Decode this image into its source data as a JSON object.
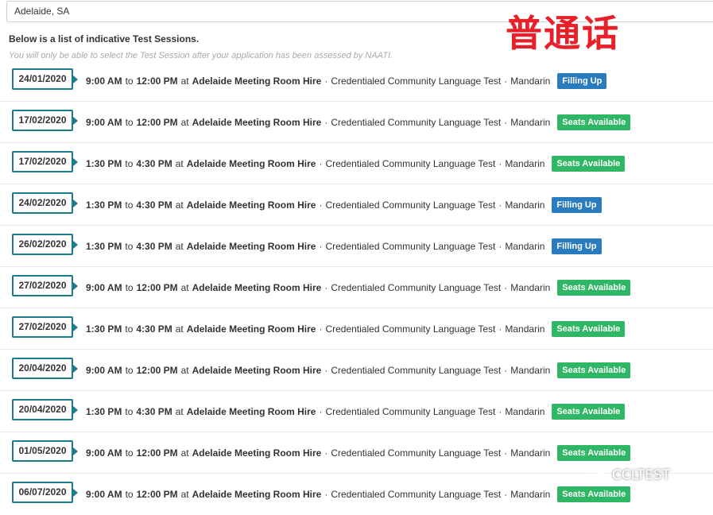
{
  "location": {
    "value": "Adelaide, SA"
  },
  "heading": "Below is a list of indicative Test Sessions.",
  "note": "You will only be able to select the Test Session after your application has been assessed by NAATI.",
  "watermark_title": "普通话",
  "watermark_brand": "CCLTEST",
  "separator": "·",
  "labels": {
    "to": "to",
    "at": "at"
  },
  "colors": {
    "date_border": "#1b7a8c",
    "filling_up": "#2a7cbf",
    "seats_available": "#2fb765",
    "watermark": "#e8202a"
  },
  "sessions": [
    {
      "date": "24/01/2020",
      "start": "9:00 AM",
      "end": "12:00 PM",
      "venue": "Adelaide Meeting Room Hire",
      "test": "Credentialed Community Language Test",
      "language": "Mandarin",
      "status": "Filling Up",
      "status_type": "filling"
    },
    {
      "date": "17/02/2020",
      "start": "9:00 AM",
      "end": "12:00 PM",
      "venue": "Adelaide Meeting Room Hire",
      "test": "Credentialed Community Language Test",
      "language": "Mandarin",
      "status": "Seats Available",
      "status_type": "seats"
    },
    {
      "date": "17/02/2020",
      "start": "1:30 PM",
      "end": "4:30 PM",
      "venue": "Adelaide Meeting Room Hire",
      "test": "Credentialed Community Language Test",
      "language": "Mandarin",
      "status": "Seats Available",
      "status_type": "seats"
    },
    {
      "date": "24/02/2020",
      "start": "1:30 PM",
      "end": "4:30 PM",
      "venue": "Adelaide Meeting Room Hire",
      "test": "Credentialed Community Language Test",
      "language": "Mandarin",
      "status": "Filling Up",
      "status_type": "filling"
    },
    {
      "date": "26/02/2020",
      "start": "1:30 PM",
      "end": "4:30 PM",
      "venue": "Adelaide Meeting Room Hire",
      "test": "Credentialed Community Language Test",
      "language": "Mandarin",
      "status": "Filling Up",
      "status_type": "filling"
    },
    {
      "date": "27/02/2020",
      "start": "9:00 AM",
      "end": "12:00 PM",
      "venue": "Adelaide Meeting Room Hire",
      "test": "Credentialed Community Language Test",
      "language": "Mandarin",
      "status": "Seats Available",
      "status_type": "seats"
    },
    {
      "date": "27/02/2020",
      "start": "1:30 PM",
      "end": "4:30 PM",
      "venue": "Adelaide Meeting Room Hire",
      "test": "Credentialed Community Language Test",
      "language": "Mandarin",
      "status": "Seats Available",
      "status_type": "seats"
    },
    {
      "date": "20/04/2020",
      "start": "9:00 AM",
      "end": "12:00 PM",
      "venue": "Adelaide Meeting Room Hire",
      "test": "Credentialed Community Language Test",
      "language": "Mandarin",
      "status": "Seats Available",
      "status_type": "seats"
    },
    {
      "date": "20/04/2020",
      "start": "1:30 PM",
      "end": "4:30 PM",
      "venue": "Adelaide Meeting Room Hire",
      "test": "Credentialed Community Language Test",
      "language": "Mandarin",
      "status": "Seats Available",
      "status_type": "seats"
    },
    {
      "date": "01/05/2020",
      "start": "9:00 AM",
      "end": "12:00 PM",
      "venue": "Adelaide Meeting Room Hire",
      "test": "Credentialed Community Language Test",
      "language": "Mandarin",
      "status": "Seats Available",
      "status_type": "seats"
    },
    {
      "date": "06/07/2020",
      "start": "9:00 AM",
      "end": "12:00 PM",
      "venue": "Adelaide Meeting Room Hire",
      "test": "Credentialed Community Language Test",
      "language": "Mandarin",
      "status": "Seats Available",
      "status_type": "seats"
    }
  ]
}
